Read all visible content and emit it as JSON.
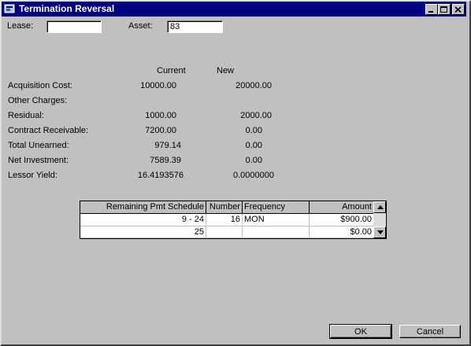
{
  "window": {
    "title": "Termination Reversal"
  },
  "filters": {
    "lease_label": "Lease:",
    "lease_value": "",
    "asset_label": "Asset:",
    "asset_value": "83"
  },
  "columns": {
    "current": "Current",
    "new": "New"
  },
  "rows": [
    {
      "label": "Acquisition Cost:",
      "current": "10000.00",
      "new": "20000.00"
    },
    {
      "label": "Other Charges:",
      "current": "",
      "new": ""
    },
    {
      "label": "Residual:",
      "current": "1000.00",
      "new": "2000.00"
    },
    {
      "label": "Contract Receivable:",
      "current": "7200.00",
      "new": "0.00"
    },
    {
      "label": "Total Unearned:",
      "current": "979.14",
      "new": "0.00"
    },
    {
      "label": "Net Investment:",
      "current": "7589.39",
      "new": "0.00"
    },
    {
      "label": "Lessor Yield:",
      "current": "16.4193576",
      "new": "0.0000000"
    }
  ],
  "schedule": {
    "headers": {
      "remaining": "Remaining Pmt Schedule",
      "number": "Number",
      "frequency": "Frequency",
      "amount": "Amount"
    },
    "rows": [
      {
        "remaining": "9 -  24",
        "number": "16",
        "frequency": "MON",
        "amount": "$900.00"
      },
      {
        "remaining": "25",
        "number": "",
        "frequency": "",
        "amount": "$0.00"
      }
    ]
  },
  "buttons": {
    "ok": "OK",
    "cancel": "Cancel"
  },
  "icons": {
    "app": "app-icon",
    "minimize": "minimize-icon",
    "maximize": "maximize-icon",
    "close": "close-icon",
    "up": "arrow-up-icon",
    "down": "arrow-down-icon"
  }
}
